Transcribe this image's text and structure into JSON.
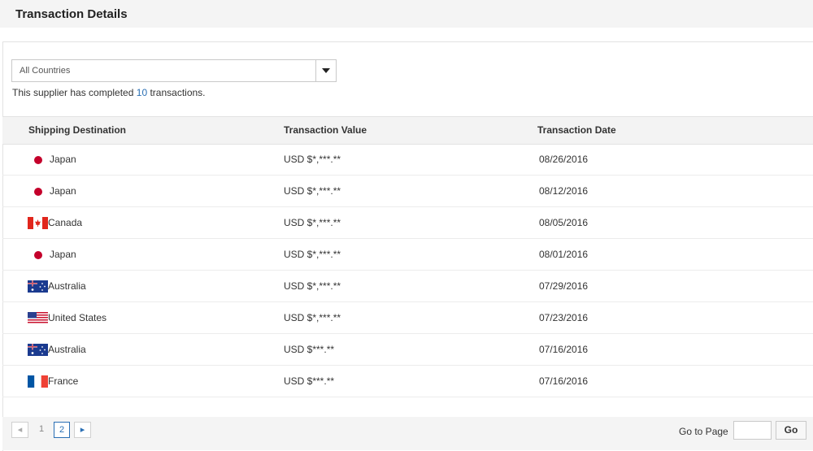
{
  "header": {
    "title": "Transaction Details"
  },
  "filter": {
    "selected": "All Countries",
    "icon": "chevron-down-icon"
  },
  "summary": {
    "prefix": "This supplier has completed",
    "count": "10",
    "suffix": "transactions."
  },
  "table": {
    "columns": [
      "Shipping Destination",
      "Transaction Value",
      "Transaction Date"
    ],
    "rows": [
      {
        "destination": "Japan",
        "flag": "japan-flag-icon",
        "value": "USD $*,***.**",
        "date": "08/26/2016"
      },
      {
        "destination": "Japan",
        "flag": "japan-flag-icon",
        "value": "USD $*,***.**",
        "date": "08/12/2016"
      },
      {
        "destination": "Canada",
        "flag": "canada-flag-icon",
        "value": "USD $*,***.**",
        "date": "08/05/2016"
      },
      {
        "destination": "Japan",
        "flag": "japan-flag-icon",
        "value": "USD $*,***.**",
        "date": "08/01/2016"
      },
      {
        "destination": "Australia",
        "flag": "australia-flag-icon",
        "value": "USD $*,***.**",
        "date": "07/29/2016"
      },
      {
        "destination": "United States",
        "flag": "united-states-flag-icon",
        "value": "USD $*,***.**",
        "date": "07/23/2016"
      },
      {
        "destination": "Australia",
        "flag": "australia-flag-icon",
        "value": "USD $***.**",
        "date": "07/16/2016"
      },
      {
        "destination": "France",
        "flag": "france-flag-icon",
        "value": "USD $***.**",
        "date": "07/16/2016"
      }
    ]
  },
  "pagination": {
    "pages": [
      "1",
      "2"
    ],
    "current": "2",
    "goto_label": "Go to Page",
    "goto_value": "",
    "go_label": "Go"
  },
  "colors": {
    "accent": "#2a6fb4",
    "header_bg": "#f4f4f4"
  }
}
